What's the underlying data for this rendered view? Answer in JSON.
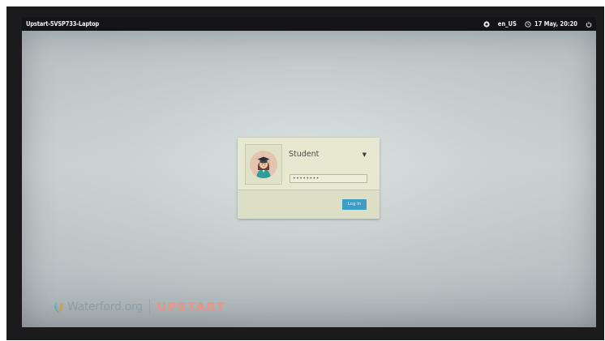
{
  "topbar": {
    "hostname": "Upstart-5VSP733-Laptop",
    "language": "en_US",
    "datetime": "17 May, 20:20",
    "icons": [
      "accessibility-icon",
      "clock-icon",
      "power-icon"
    ]
  },
  "login": {
    "username": "Student",
    "password_masked": "••••••••",
    "login_button": "Log In"
  },
  "branding": {
    "waterford": "Waterford.org",
    "upstart": "UPSTART"
  },
  "colors": {
    "topbar": "#141416",
    "screen": "#c3cbcc",
    "card": "#e6e9d0",
    "button": "#3c9ec4",
    "upstart": "#e5978b"
  }
}
